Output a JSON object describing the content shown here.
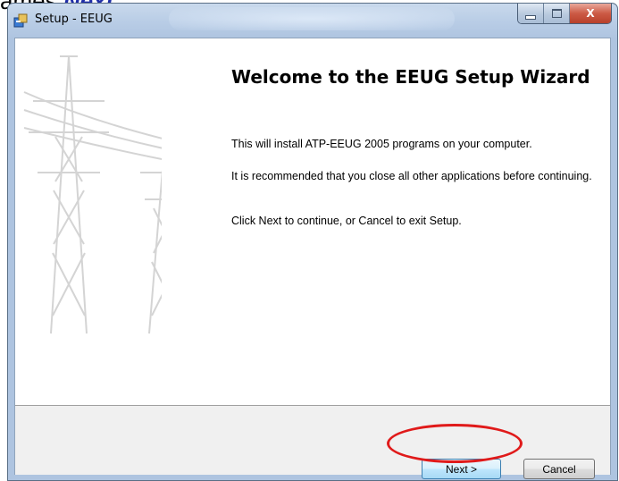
{
  "document_caption": {
    "prefix": "ames ",
    "emphasis": "Next"
  },
  "window": {
    "title": "Setup - EEUG",
    "controls": {
      "minimize": "",
      "maximize": "",
      "close": "X"
    }
  },
  "wizard": {
    "heading": "Welcome to the EEUG Setup Wizard",
    "paragraphs": [
      "This will install ATP-EEUG 2005 programs on your computer.",
      "It is recommended that you close all other applications before continuing.",
      "Click Next to continue, or Cancel to exit Setup."
    ]
  },
  "buttons": {
    "next": "Next >",
    "cancel": "Cancel"
  },
  "colors": {
    "highlight": "#e01a1a",
    "caption_emphasis": "#1f2ea8",
    "titlebar": "#b9cde6"
  }
}
